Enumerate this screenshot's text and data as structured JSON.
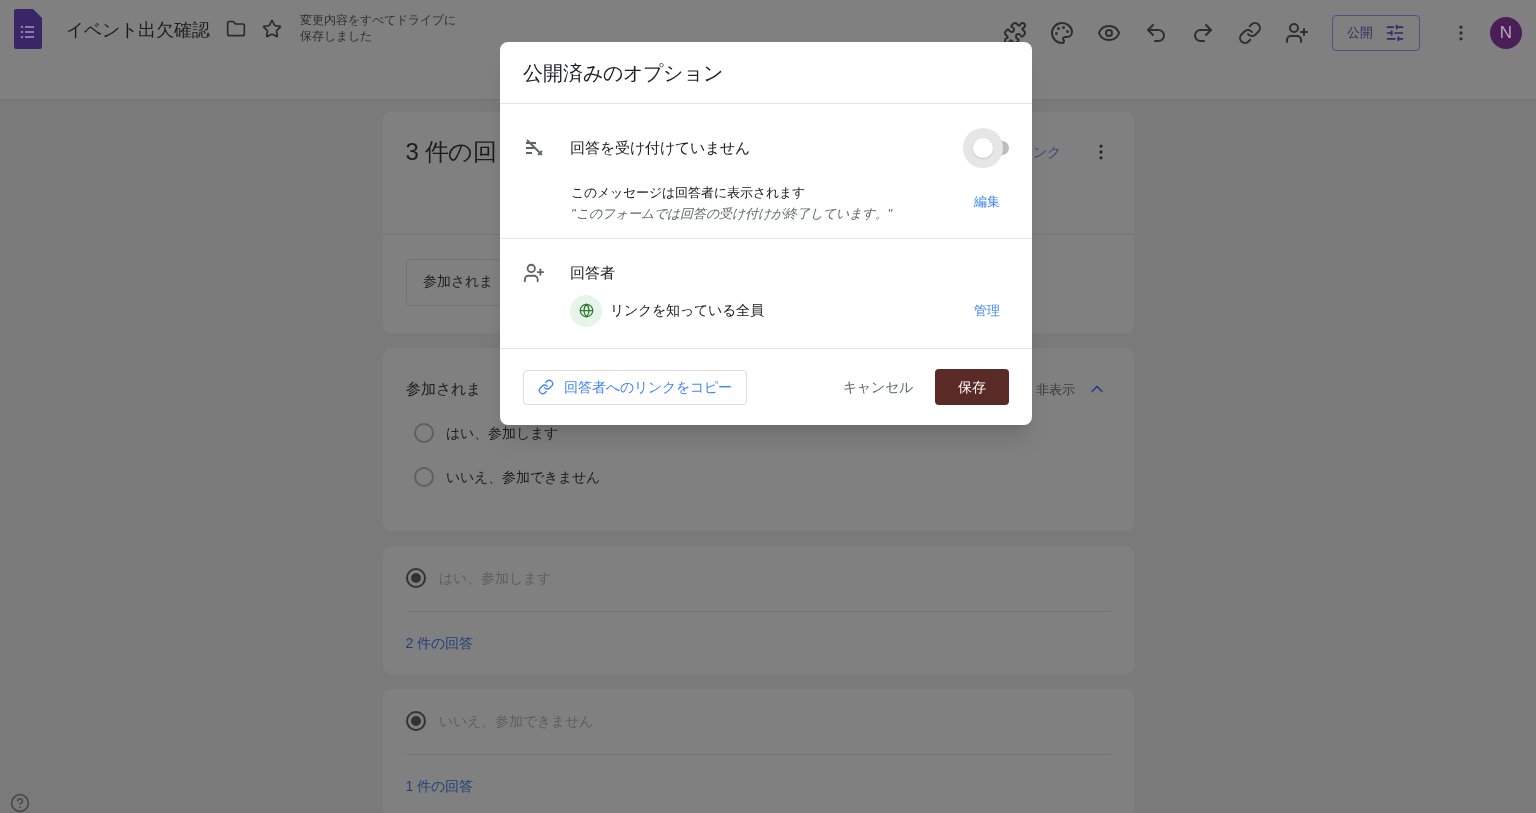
{
  "header": {
    "title": "イベント出欠確認",
    "save_status": "変更内容をすべてドライブに保存しました",
    "publish_button": "公開",
    "avatar": "N"
  },
  "summary_card": {
    "title": "3 件の回",
    "link": "ンク",
    "question_select": "参加されま"
  },
  "question_card": {
    "title": "参加されま",
    "hide_label": "非表示",
    "options": [
      {
        "label": "はい、参加します",
        "selected": false
      },
      {
        "label": "いいえ、参加できません",
        "selected": false
      }
    ]
  },
  "answer_cards": [
    {
      "option": "はい、参加します",
      "selected": true,
      "count": "2 件の回答"
    },
    {
      "option": "いいえ、参加できません",
      "selected": true,
      "count": "1 件の回答"
    }
  ],
  "dialog": {
    "title": "公開済みのオプション",
    "accepting": {
      "label": "回答を受け付けていません",
      "on": false
    },
    "message_label": "このメッセージは回答者に表示されます",
    "message": "\"このフォームでは回答の受け付けが終了しています。\"",
    "edit_link": "編集",
    "respondents_title": "回答者",
    "audience": "リンクを知っている全員",
    "manage_link": "管理",
    "copy_link": "回答者へのリンクをコピー",
    "cancel": "キャンセル",
    "save": "保存"
  }
}
